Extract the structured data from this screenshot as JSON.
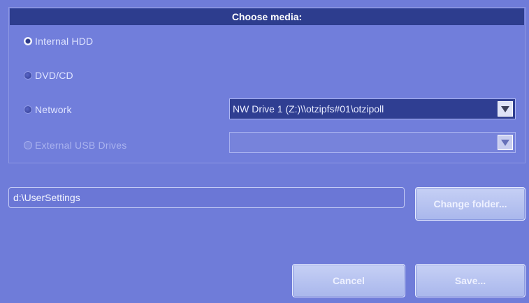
{
  "dialog": {
    "title": "Choose media:"
  },
  "media_options": [
    {
      "label": "Internal HDD",
      "selected": true,
      "enabled": true
    },
    {
      "label": "DVD/CD",
      "selected": false,
      "enabled": true
    },
    {
      "label": "Network",
      "selected": false,
      "enabled": true
    },
    {
      "label": "External USB Drives",
      "selected": false,
      "enabled": false
    }
  ],
  "network_drive": {
    "selected_value": "NW Drive 1 (Z:)\\\\otzipfs#01\\otzipoll"
  },
  "usb_drive": {
    "selected_value": ""
  },
  "folder": {
    "path": "d:\\UserSettings",
    "change_label": "Change folder..."
  },
  "actions": {
    "cancel_label": "Cancel",
    "save_label": "Save..."
  },
  "colors": {
    "background": "#6f7cd9",
    "title_bar": "#2d3d8e",
    "dropdown_active": "#2f3e92",
    "button": "#b3c0f0"
  }
}
